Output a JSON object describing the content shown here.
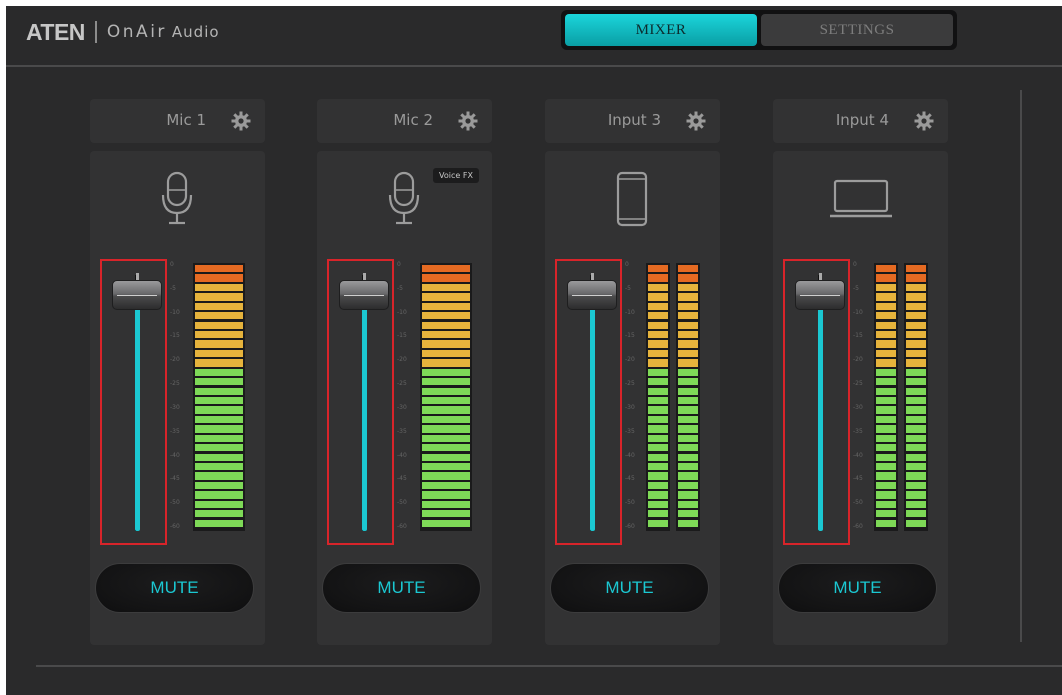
{
  "app": {
    "logo_brand": "ATEN",
    "logo_product": "OnAir",
    "logo_sub": "Audio"
  },
  "tabs": [
    {
      "label": "MIXER",
      "active": true
    },
    {
      "label": "SETTINGS",
      "active": false
    }
  ],
  "colors": {
    "accent": "#1bc8d2",
    "highlight_box": "#d8242a",
    "meter_green": "#7ed957",
    "meter_yellow": "#e6b33c",
    "meter_orange": "#e56a22"
  },
  "meter_scale": [
    "0",
    "-5",
    "-10",
    "-15",
    "-20",
    "-25",
    "-30",
    "-35",
    "-40",
    "-45",
    "-50",
    "-60"
  ],
  "channels": [
    {
      "name": "Mic 1",
      "icon": "microphone-icon",
      "badge": "",
      "fader_level": 0.92,
      "meter_channels": 1,
      "meter_level": 1.0,
      "mute_label": "MUTE"
    },
    {
      "name": "Mic 2",
      "icon": "microphone-icon",
      "badge": "Voice FX",
      "fader_level": 0.92,
      "meter_channels": 1,
      "meter_level": 1.0,
      "mute_label": "MUTE"
    },
    {
      "name": "Input 3",
      "icon": "smartphone-icon",
      "badge": "",
      "fader_level": 0.92,
      "meter_channels": 2,
      "meter_level": 1.0,
      "mute_label": "MUTE"
    },
    {
      "name": "Input 4",
      "icon": "laptop-icon",
      "badge": "",
      "fader_level": 0.92,
      "meter_channels": 2,
      "meter_level": 1.0,
      "mute_label": "MUTE"
    }
  ]
}
